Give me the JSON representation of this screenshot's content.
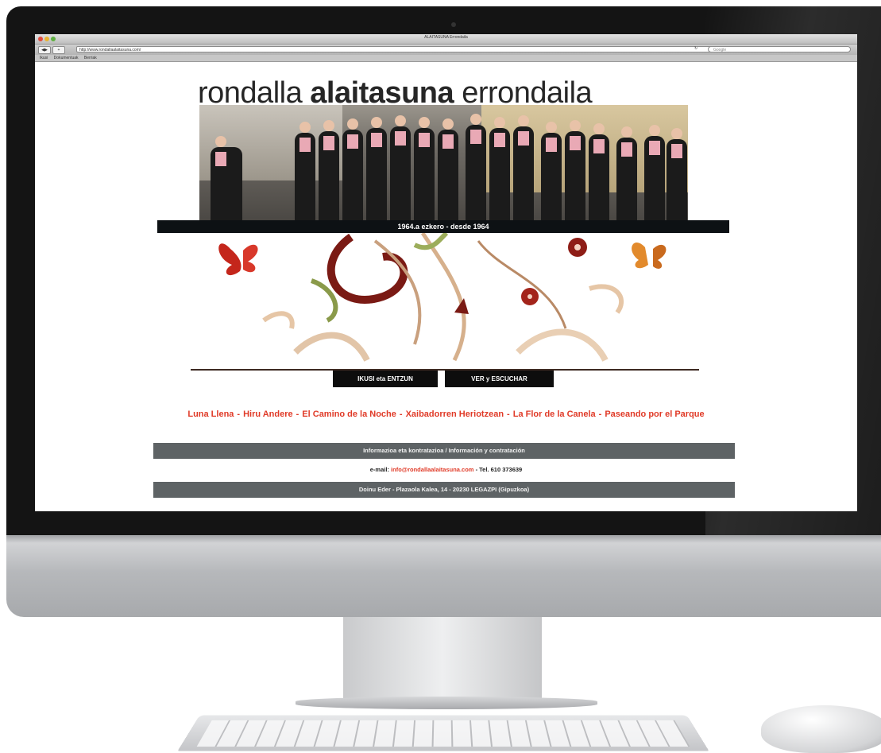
{
  "browser": {
    "window_title": "ALAITASUNA Errondaila",
    "url": "http://www.rondallaalaitasuna.com/",
    "search_placeholder": "Google",
    "bookmarks": [
      "Ikusi",
      "Dokumentuak",
      "Berriak"
    ]
  },
  "site": {
    "title_left": "rondalla ",
    "title_bold": "alaitasuna",
    "title_right": " errondaila",
    "since_strip": "1964.a ezkero -  desde 1964",
    "tab_buttons": [
      "IKUSI eta ENTZUN",
      "VER y ESCUCHAR"
    ],
    "songs": [
      "Luna Llena",
      "Hiru Andere",
      "El Camino de la Noche",
      "Xaibadorren Heriotzean",
      "La Flor de la Canela",
      "Paseando por el Parque"
    ],
    "info_title": "Informazioa eta kontratazioa / Información y contratación",
    "email_label": "e-mail:",
    "email": "info@rondallaalaitasuna.com",
    "phone": "Tel. 610 373639",
    "address": "Doinu Eder - Plazaola Kalea, 14 - 20230 LEGAZPI (Gipuzkoa)"
  },
  "colors": {
    "accent_red": "#e03a27",
    "bar_grey": "#5e6365",
    "strip_dark": "#0d1114"
  },
  "icons": [
    "back-icon",
    "forward-icon",
    "add-tab-icon",
    "reload-icon",
    "search-icon",
    "butterfly-icon",
    "floral-ornament-icon"
  ]
}
